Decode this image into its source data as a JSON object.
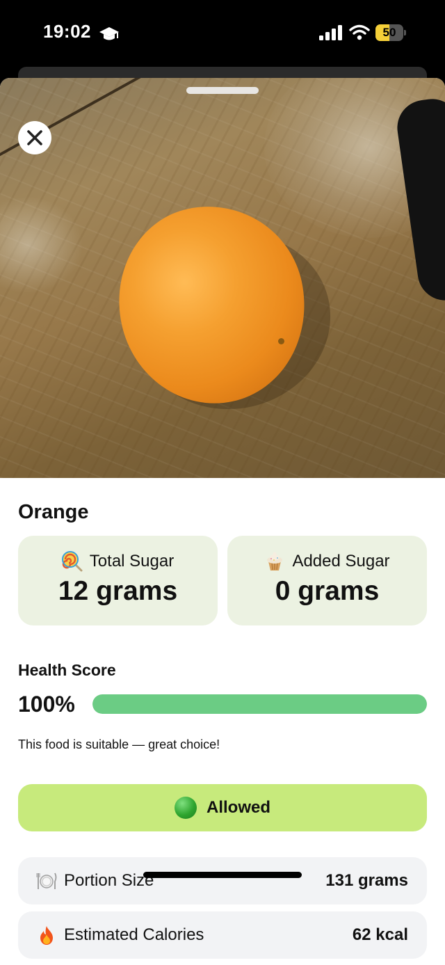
{
  "status_bar": {
    "time": "19:02",
    "battery_level": "50",
    "battery_fraction": 0.5,
    "icons": [
      "graduation-cap-icon",
      "cellular-signal-icon",
      "wifi-icon",
      "battery-icon"
    ]
  },
  "photo": {
    "subject_icon": "orange-photo"
  },
  "close_icon": "close-icon",
  "food": {
    "name": "Orange"
  },
  "sugar_cards": {
    "total": {
      "icon": "lollipop-icon",
      "label": "Total Sugar",
      "value": "12 grams"
    },
    "added": {
      "icon": "cupcake-icon",
      "label": "Added Sugar",
      "value": "0 grams"
    }
  },
  "health": {
    "label": "Health Score",
    "score_text": "100%",
    "score": 1.0,
    "message": "This food is suitable — great choice!"
  },
  "verdict": {
    "icon": "green-circle-icon",
    "label": "Allowed",
    "color": "#c7ea7c"
  },
  "details": {
    "portion": {
      "icon": "plate-icon",
      "label": "Portion Size",
      "value": "131 grams"
    },
    "calories": {
      "icon": "fire-icon",
      "label": "Estimated Calories",
      "value": "62 kcal"
    }
  },
  "colors": {
    "card_bg": "#ecf2e2",
    "score_fill": "#6bcc84",
    "row_bg": "#f2f3f5"
  }
}
